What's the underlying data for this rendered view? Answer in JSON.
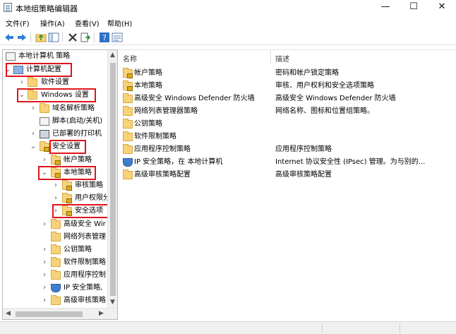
{
  "window": {
    "title": "本地组策略编辑器",
    "minimize_glyph": "—",
    "maximize_glyph": "☐",
    "close_glyph": "✕"
  },
  "menu": [
    "文件(F)",
    "操作(A)",
    "查看(V)",
    "帮助(H)"
  ],
  "toolbar_icons": [
    "back-arrow-icon",
    "forward-arrow-icon",
    "up-folder-icon",
    "show-tree-icon",
    "delete-icon",
    "export-list-icon",
    "help-icon",
    "properties-icon"
  ],
  "tree": {
    "root": "本地计算机 策略",
    "computer_config": "计算机配置",
    "software_settings": "软件设置",
    "windows_settings": "Windows 设置",
    "dns_policy": "域名解析策略",
    "scripts": "脚本(启动/关机)",
    "printers": "已部署的打印机",
    "security_settings": "安全设置",
    "account_policy": "帐户策略",
    "local_policy": "本地策略",
    "audit_policy": "审核策略",
    "user_rights": "用户权限分",
    "security_options": "安全选项",
    "adv_firewall": "高级安全 Wir",
    "network_list": "网络列表管理",
    "public_key": "公钥策略",
    "software_restriction": "软件限制策略",
    "app_control": "应用程序控制",
    "ip_security": "IP 安全策略,",
    "adv_audit": "高级审核策略"
  },
  "list": {
    "headers": {
      "name": "名称",
      "description": "描述"
    },
    "rows": [
      {
        "name": "帐户策略",
        "description": "密码和帐户锁定策略"
      },
      {
        "name": "本地策略",
        "description": "审核、用户权利和安全选项策略"
      },
      {
        "name": "高级安全 Windows Defender 防火墙",
        "description": "高级安全 Windows Defender 防火墙"
      },
      {
        "name": "网络列表管理器策略",
        "description": "网络名称、图标和位置组策略。"
      },
      {
        "name": "公钥策略",
        "description": ""
      },
      {
        "name": "软件限制策略",
        "description": ""
      },
      {
        "name": "应用程序控制策略",
        "description": "应用程序控制策略"
      },
      {
        "name": "IP 安全策略，在 本地计算机",
        "description": "Internet 协议安全性 (IPsec) 管理。为与别的..."
      },
      {
        "name": "高级审核策略配置",
        "description": "高级审核策略配置"
      }
    ]
  },
  "colors": {
    "highlight_box": "#e0141b",
    "folder": "#f6d37a"
  }
}
